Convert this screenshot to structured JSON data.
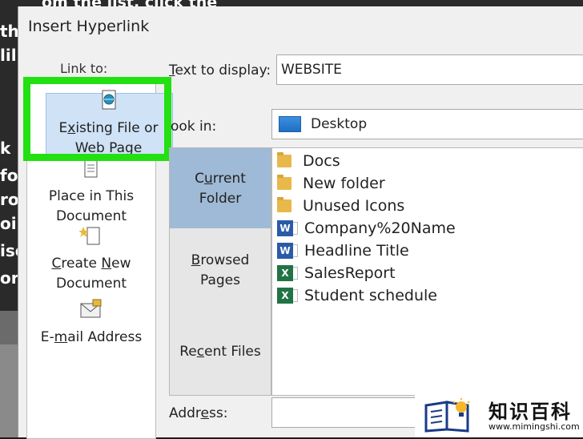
{
  "background": {
    "top_text": "om the list, click the",
    "side_lines": [
      "th",
      "lil",
      "k",
      "fo",
      "ro",
      "oin",
      "ise",
      "or"
    ]
  },
  "dialog": {
    "title": "Insert Hyperlink",
    "link_to_label": "Link to:"
  },
  "link_to": {
    "existing": {
      "line1": "Existing File or",
      "line2": "Web Page"
    },
    "place": {
      "line1": "Place in This",
      "line2": "Document"
    },
    "create_new": {
      "line1": "Create New",
      "line2": "Document"
    },
    "email": {
      "label": "E-mail Address"
    }
  },
  "text_to_display": {
    "label": "Text to display:",
    "value": "WEBSITE"
  },
  "look_in": {
    "label": "ook in:",
    "value": "Desktop"
  },
  "nav": {
    "current_folder": {
      "line1": "Current",
      "line2": "Folder"
    },
    "browsed_pages": {
      "line1": "Browsed",
      "line2": "Pages"
    },
    "recent_files": {
      "label": "Recent Files"
    }
  },
  "files": [
    {
      "name": "Docs",
      "type": "folder"
    },
    {
      "name": "New folder",
      "type": "folder"
    },
    {
      "name": "Unused Icons",
      "type": "folder"
    },
    {
      "name": "Company%20Name",
      "type": "word"
    },
    {
      "name": "Headline Title",
      "type": "word"
    },
    {
      "name": "SalesReport",
      "type": "excel"
    },
    {
      "name": "Student schedule",
      "type": "excel"
    }
  ],
  "address": {
    "label": "Address:",
    "value": ""
  },
  "watermark": {
    "cn": "知识百科",
    "url": "www.mimingshi.com"
  },
  "colors": {
    "highlight_green": "#22e012",
    "selected_blue": "#cfe2f6",
    "nav_current": "#9fbad6"
  }
}
